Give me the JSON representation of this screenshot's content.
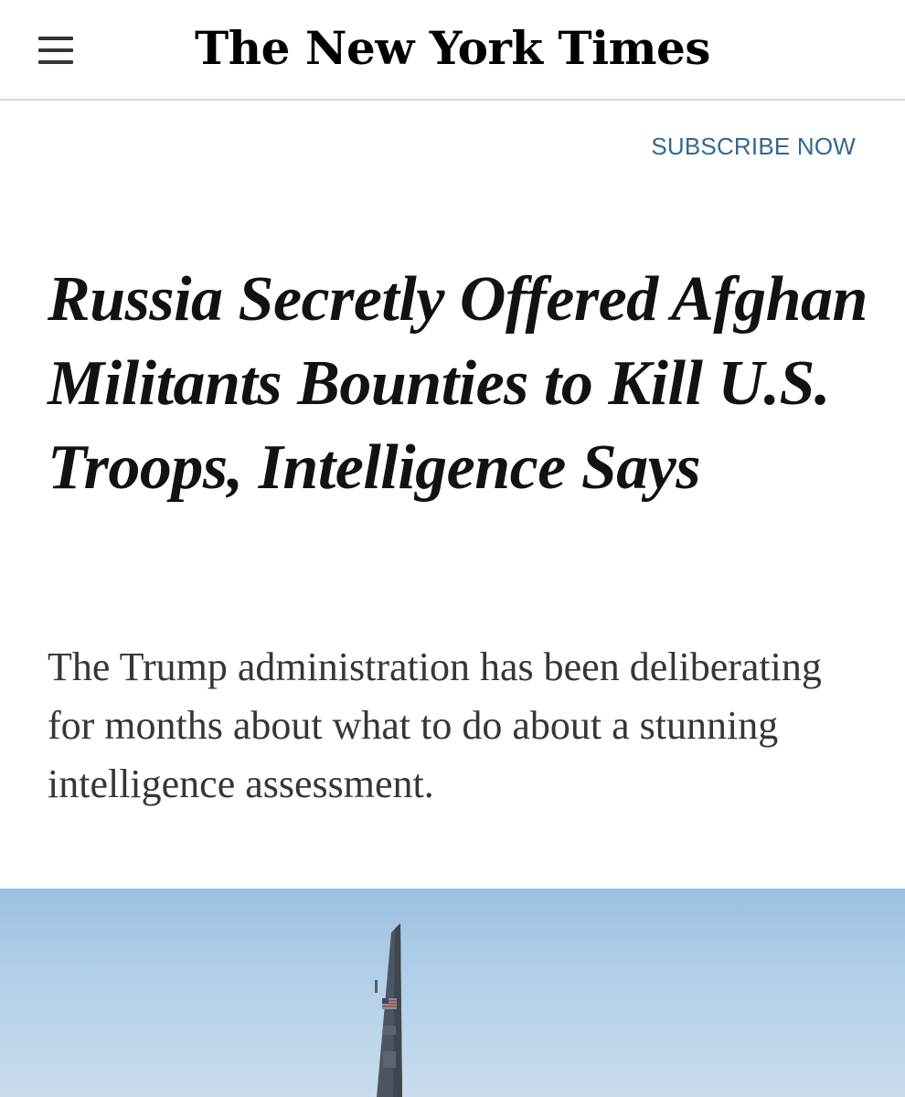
{
  "header": {
    "masthead": "The New York Times",
    "menu_icon": "hamburger-menu-icon"
  },
  "subscribe": {
    "label": "SUBSCRIBE NOW",
    "color": "#326891"
  },
  "article": {
    "headline": "Russia Secretly Offered Afghan Militants Bounties to Kill U.S. Troops, Intelligence Says",
    "summary": "The Trump administration has been deliberating for months about what to do about a stunning intelligence assessment."
  },
  "lead_image": {
    "subject": "aircraft-tail-against-sky"
  }
}
